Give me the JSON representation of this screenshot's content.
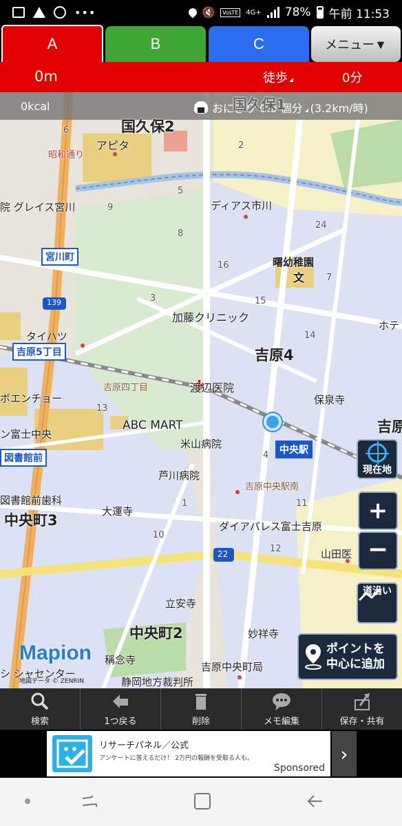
{
  "status_bar": {
    "battery": "78%",
    "time": "午前 11:53",
    "network": "4G+",
    "volte": "VoLTE",
    "dots": "•••",
    "icons": [
      "image-icon",
      "warning-icon",
      "b-app-icon",
      "location-icon",
      "mute-icon",
      "signal-icon",
      "battery-icon"
    ]
  },
  "tabs": {
    "a": "A",
    "b": "B",
    "c": "C",
    "menu": "メニュー▼",
    "colors": {
      "a": "#e20000",
      "b": "#3fa535",
      "c": "#2c6df0"
    }
  },
  "route_info": {
    "distance": "0m",
    "mode": "徒歩",
    "duration": "0分"
  },
  "kcal_bar": {
    "kcal": "0kcal",
    "onigiri": "おにぎり 0.0 個分",
    "speed": "(3.2km/時)"
  },
  "map": {
    "areas": {
      "kokubo": "国久保2",
      "kokubo_top": "国久保1",
      "yoshiwara4": "吉原4",
      "chuocho3": "中央町3",
      "chuocho2": "中央町2",
      "yoshiwara_right": "吉原"
    },
    "places": {
      "apita": "アピタ",
      "showa": "昭和通り",
      "grace": "院 グレイス宮川",
      "dias": "ディアス市川",
      "akebono": "曙幼稚園",
      "kindergarten_mark": "文",
      "kato": "加藤クリニック",
      "daihatsu": "タイハツ",
      "yoshiwara5": "吉原5丁目",
      "miyagawa": "宮川町",
      "hotel": "ホテ",
      "yoshiwara4chome": "吉原四丁目",
      "watanabe": "渡辺医院",
      "hosen": "保泉寺",
      "bsencho": "ボエンチョー",
      "fujichuo": "ン富士中央",
      "abcmart": "ABC MART",
      "yoneyama": "米山病院",
      "toshokanmae": "図書館前",
      "ashikawa": "芦川病院",
      "chuoeki": "中央駅",
      "yoshiwara_chuo_minami": "吉原中央駅南",
      "shika": "図書館前歯科",
      "daiunji": "大運寺",
      "diapalace": "ダイアパレス富士吉原",
      "yamada": "山田医",
      "ryuanji": "立安寺",
      "myoshoji": "妙祥寺",
      "shonenji": "稱念寺",
      "yoshiwara_chuocho": "吉原中央町局",
      "shizuoka_court": "静岡地方裁判所",
      "shiyakusho": "シ シャセンター",
      "route139": "139",
      "route22": "22"
    },
    "block_numbers": [
      "6",
      "5",
      "2",
      "3",
      "9",
      "8",
      "16",
      "15",
      "13",
      "14",
      "24",
      "7",
      "4",
      "10",
      "11",
      "12",
      "1"
    ],
    "brand": "Mapion",
    "copyright": "地図データ © ZENRIN"
  },
  "map_buttons": {
    "current": "現在地",
    "zoom_in": "+",
    "zoom_out": "−",
    "along_road": "道沿い",
    "add_point_line1": "ポイントを",
    "add_point_line2": "中心に追加"
  },
  "toolbar": {
    "search": "検索",
    "back": "1つ戻る",
    "delete": "削除",
    "memo": "メモ編集",
    "save": "保存・共有"
  },
  "ad": {
    "title": "リサーチパネル／公式",
    "desc": "アンケートに答えるだけ！ 2万円の報酬を受取る人も。",
    "sponsored": "Sponsored",
    "next": "›"
  }
}
